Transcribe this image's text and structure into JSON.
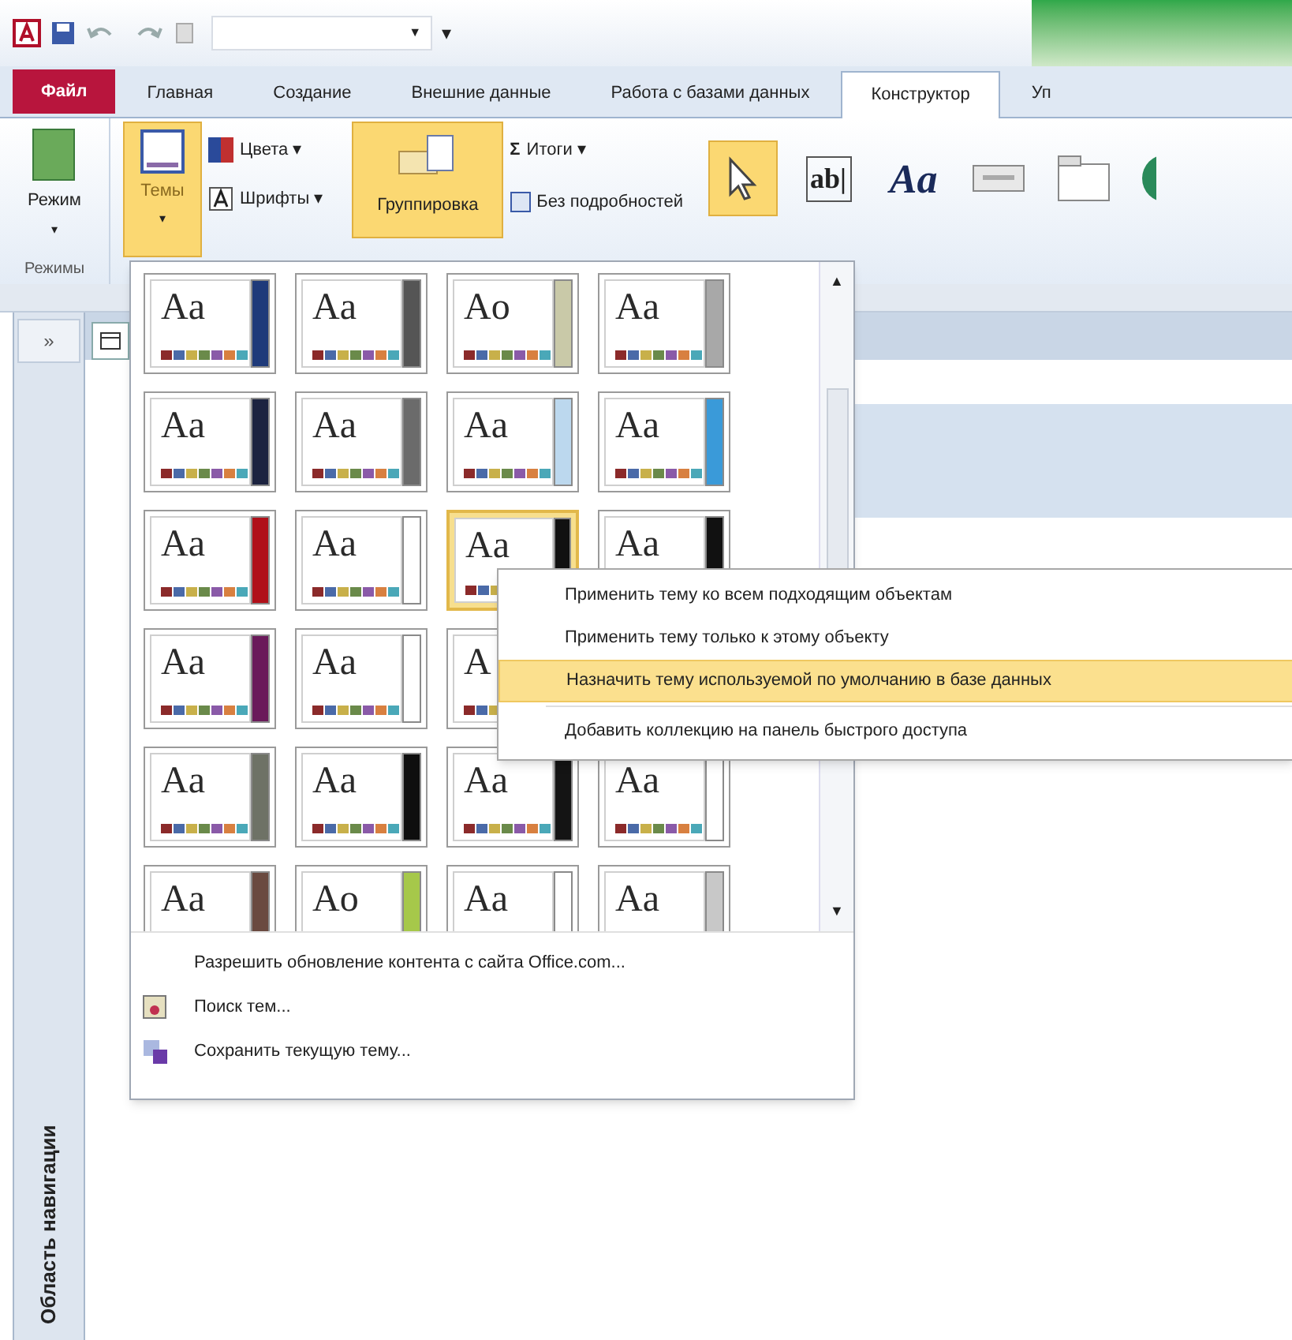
{
  "quick_access": {
    "field_caret": "▼",
    "customize": "▾"
  },
  "tabs": [
    {
      "label": "Файл",
      "kind": "file",
      "selected": false
    },
    {
      "label": "Главная",
      "kind": "tab",
      "selected": false
    },
    {
      "label": "Создание",
      "kind": "tab",
      "selected": false
    },
    {
      "label": "Внешние данные",
      "kind": "tab",
      "selected": false
    },
    {
      "label": "Работа с базами данных",
      "kind": "tab",
      "selected": false
    },
    {
      "label": "Конструктор",
      "kind": "tab",
      "selected": true
    },
    {
      "label": "Уп",
      "kind": "tab",
      "selected": false
    }
  ],
  "ribbon": {
    "views_button": {
      "label": "Режим",
      "caret": "▾"
    },
    "themes_button": {
      "label": "Темы",
      "caret": "▾",
      "selected": true
    },
    "colors_button": {
      "label": "Цвета",
      "caret": "▾"
    },
    "fonts_button": {
      "label": "Шрифты",
      "caret": "▾"
    },
    "grouping_button": {
      "label": "Группировка",
      "selected": true
    },
    "totals_button": {
      "icon": "Σ",
      "label": "Итоги",
      "caret": "▾"
    },
    "no_details_button": {
      "label": "Без подробностей"
    },
    "controls": [
      {
        "kind": "pointer",
        "selected": true
      },
      {
        "kind": "textbox",
        "label": "ab|",
        "selected": false
      },
      {
        "kind": "label",
        "label": "Aa",
        "selected": false
      },
      {
        "kind": "button",
        "selected": false
      },
      {
        "kind": "tab",
        "selected": false
      }
    ],
    "group_label": "Режимы"
  },
  "nav_pane": {
    "expand": "»",
    "title": "Область навигации"
  },
  "theme_gallery": {
    "rows": [
      [
        {
          "label": "Aa",
          "color": "#1f3a7a",
          "selected": false
        },
        {
          "label": "Aa",
          "color": "#555555",
          "selected": false
        },
        {
          "label": "Ao",
          "color": "#c9c9a8",
          "selected": false
        },
        {
          "label": "Aa",
          "color": "#a8a8a8",
          "selected": false
        }
      ],
      [
        {
          "label": "Aa",
          "color": "#1c2340",
          "selected": false
        },
        {
          "label": "Aa",
          "color": "#6b6b6b",
          "selected": false
        },
        {
          "label": "Aa",
          "color": "#bcd8ee",
          "selected": false
        },
        {
          "label": "Aa",
          "color": "#3a9ad9",
          "selected": false
        }
      ],
      [
        {
          "label": "Aa",
          "color": "#b0101a",
          "selected": false
        },
        {
          "label": "Aa",
          "color": "#ffffff",
          "selected": false
        },
        {
          "label": "Aa",
          "color": "#111111",
          "selected": true
        },
        {
          "label": "Aa",
          "color": "#111111",
          "selected": false
        }
      ],
      [
        {
          "label": "Aa",
          "color": "#6a1a5a",
          "selected": false
        },
        {
          "label": "Aa",
          "color": "#ffffff",
          "selected": false
        },
        {
          "label": "A",
          "selected": false
        }
      ],
      [
        {
          "label": "Aa",
          "color": "#6e7266",
          "selected": false
        },
        {
          "label": "Aa",
          "color": "#0e0e0e",
          "selected": false
        },
        {
          "label": "Aa",
          "color": "#141414",
          "selected": false
        },
        {
          "label": "Aa",
          "color": "#ffffff",
          "selected": false
        }
      ],
      [
        {
          "label": "Aa",
          "color": "#6a4a40",
          "selected": false
        },
        {
          "label": "Ao",
          "color": "#a6c84a",
          "selected": false
        },
        {
          "label": "Aa",
          "color": "#ffffff",
          "selected": false
        },
        {
          "label": "Aa",
          "color": "#c8c8c8",
          "selected": false
        }
      ]
    ],
    "scroll_up": "▲",
    "scroll_down": "▼",
    "footer": [
      {
        "kind": "plain",
        "label": "Разрешить обновление контента с сайта Office.com..."
      },
      {
        "kind": "search",
        "label": "Поиск тем..."
      },
      {
        "kind": "save",
        "label": "Сохранить текущую тему..."
      }
    ]
  },
  "context_menu": {
    "items": [
      {
        "label": "Применить тему ко всем подходящим объектам",
        "selected": false
      },
      {
        "label": "Применить тему только к этому объекту",
        "selected": false
      },
      {
        "label": "Назначить тему используемой по умолчанию в базе данных",
        "selected": true
      },
      {
        "label": "Добавить коллекцию на панель быстрого доступа",
        "selected": false
      }
    ]
  }
}
